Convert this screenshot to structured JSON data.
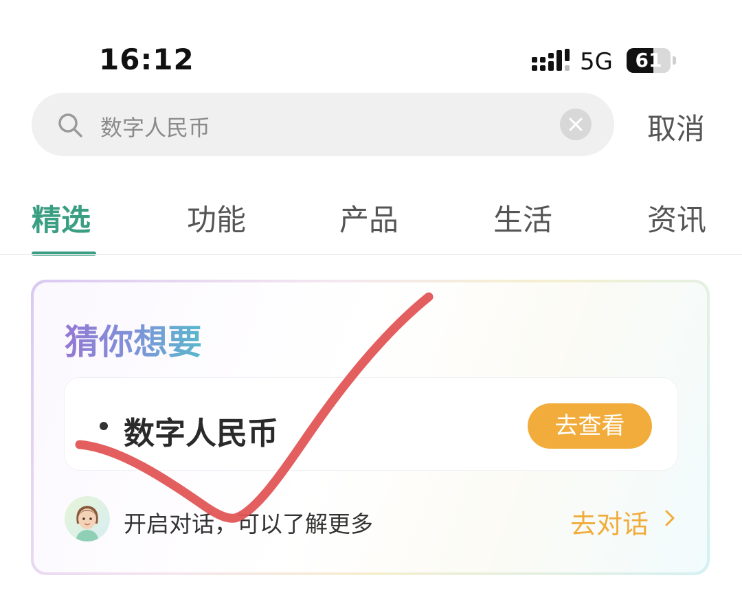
{
  "status_bar": {
    "time": "16:12",
    "network": "5G",
    "battery": "61",
    "battery_level": 0.61
  },
  "search": {
    "query": "数字人民币",
    "cancel_label": "取消"
  },
  "tabs": [
    {
      "label": "精选",
      "active": true
    },
    {
      "label": "功能",
      "active": false
    },
    {
      "label": "产品",
      "active": false
    },
    {
      "label": "生活",
      "active": false
    },
    {
      "label": "资讯",
      "active": false
    }
  ],
  "guess_card": {
    "title": "猜你想要",
    "suggestion": "数字人民币",
    "view_button": "去查看",
    "dialog_prompt": "开启对话，可以了解更多",
    "dialog_link": "去对话"
  },
  "colors": {
    "accent": "#3a9e82",
    "orange": "#f1ac3b",
    "annotation_stroke": "#e25656"
  },
  "icons": [
    "search-icon",
    "clear-icon",
    "signal-icon",
    "battery-icon",
    "avatar-icon",
    "chevron-right-icon"
  ]
}
